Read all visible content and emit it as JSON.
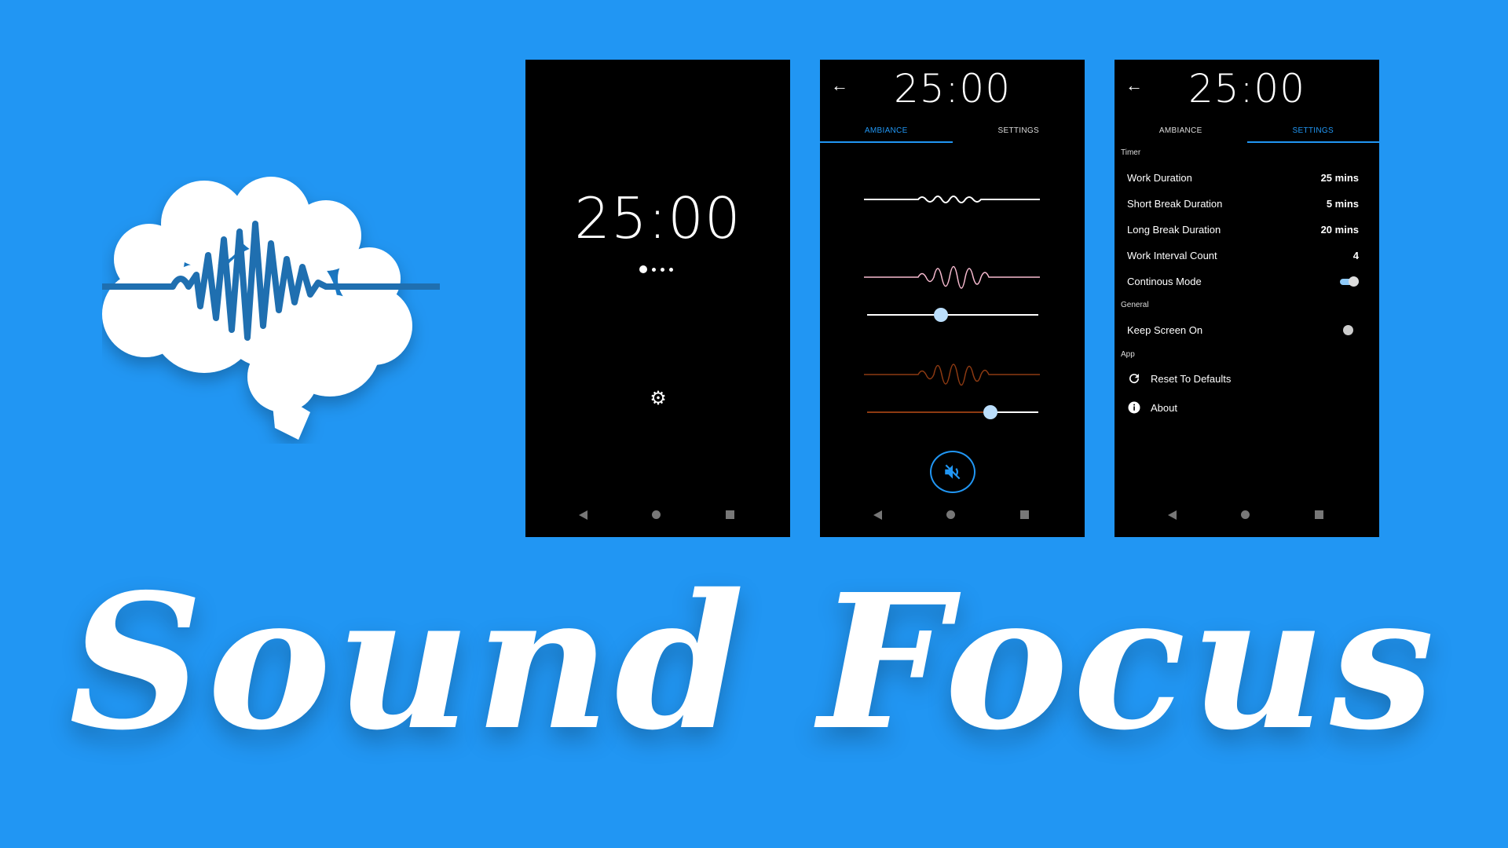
{
  "brand": {
    "name": "Sound Focus",
    "bg_color": "#2196F3",
    "accent": "#2196F3"
  },
  "screens": {
    "timer": {
      "time": "25:00",
      "interval_dots": 4,
      "active_dot": 0,
      "settings_icon": "gear-icon"
    },
    "ambiance": {
      "time": "25:00",
      "tabs": [
        {
          "label": "AMBIANCE",
          "active": true
        },
        {
          "label": "SETTINGS",
          "active": false
        }
      ],
      "sounds": [
        {
          "color": "#FFFFFF",
          "volume": null
        },
        {
          "color": "#F8BBD0",
          "volume": 0.43
        },
        {
          "color": "#8D3A12",
          "volume": 0.72
        }
      ],
      "mute_icon": "volume-off-icon"
    },
    "settings": {
      "time": "25:00",
      "tabs": [
        {
          "label": "AMBIANCE",
          "active": false
        },
        {
          "label": "SETTINGS",
          "active": true
        }
      ],
      "sections": {
        "timer": {
          "header": "Timer",
          "work_duration": {
            "label": "Work Duration",
            "value": "25 mins"
          },
          "short_break": {
            "label": "Short Break Duration",
            "value": "5 mins"
          },
          "long_break": {
            "label": "Long Break Duration",
            "value": "20 mins"
          },
          "interval_count": {
            "label": "Work Interval Count",
            "value": "4"
          },
          "continuous": {
            "label": "Continous Mode",
            "on": true
          }
        },
        "general": {
          "header": "General",
          "keep_screen_on": {
            "label": "Keep Screen On",
            "on": false
          }
        },
        "app": {
          "header": "App",
          "reset": {
            "label": "Reset To Defaults",
            "icon": "refresh-icon"
          },
          "about": {
            "label": "About",
            "icon": "info-icon"
          }
        }
      }
    }
  }
}
